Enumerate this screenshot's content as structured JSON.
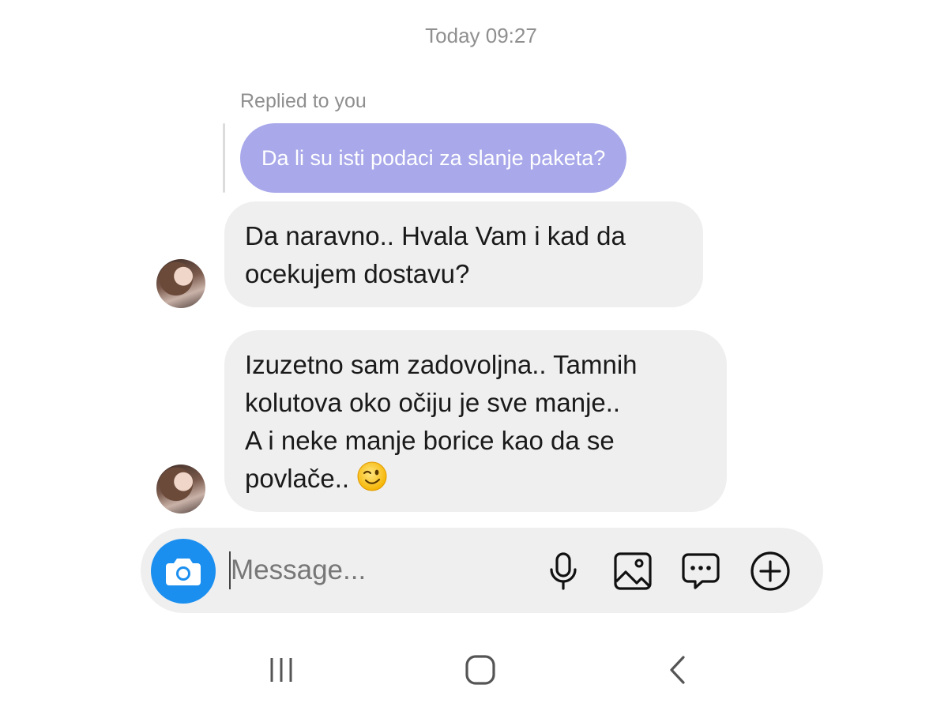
{
  "thread": {
    "timestamp": "Today 09:27",
    "reply_label": "Replied to you",
    "quoted_message": "Da li su isti podaci za slanje paketa?",
    "messages": [
      {
        "lines": [
          "Da naravno.. Hvala Vam i kad da",
          "ocekujem dostavu?"
        ]
      },
      {
        "lines": [
          "Izuzetno sam zadovoljna.. Tamnih",
          "kolutova oko očiju je sve manje..",
          "A i neke manje borice kao da se",
          "povlače.."
        ],
        "emoji": "winking-face-icon"
      }
    ]
  },
  "composer": {
    "placeholder": "Message...",
    "value": "",
    "icons": [
      "camera-icon",
      "microphone-icon",
      "gallery-icon",
      "sticker-icon",
      "plus-icon"
    ]
  },
  "navbar": {
    "icons": [
      "recents-icon",
      "home-icon",
      "back-icon"
    ]
  },
  "colors": {
    "reply_bubble": "#a8a8ea",
    "incoming_bubble": "#efefef",
    "camera_button": "#1a8ff0",
    "timestamp_text": "#8f8f8f"
  }
}
